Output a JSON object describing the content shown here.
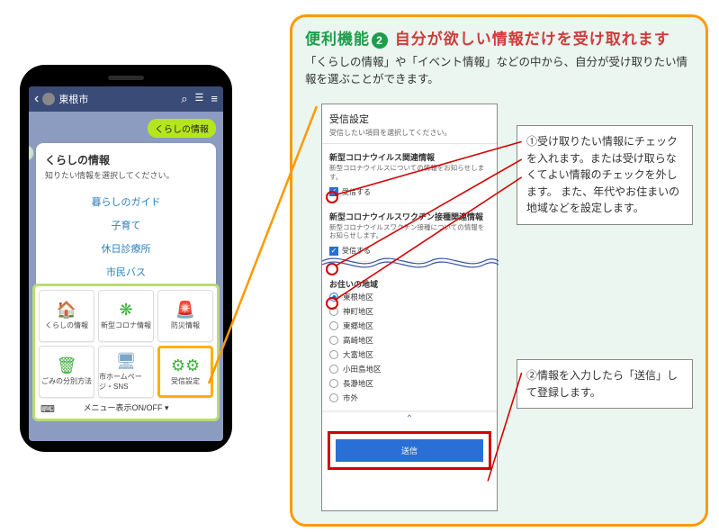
{
  "phone": {
    "app_bar": {
      "title": "東根市"
    },
    "bubble_right": "くらしの情報",
    "card": {
      "title": "くらしの情報",
      "subtitle": "知りたい情報を選択してください。",
      "links": [
        "暮らしのガイド",
        "子育て",
        "休日診療所",
        "市民バス"
      ]
    },
    "tiles": [
      {
        "label": "くらしの情報",
        "icon": "🏠",
        "color": "ic-green"
      },
      {
        "label": "新型コロナ情報",
        "icon": "❋",
        "color": "ic-green"
      },
      {
        "label": "防災情報",
        "icon": "🚨",
        "color": "ic-yellow"
      },
      {
        "label": "ごみの分別方法",
        "icon": "🗑",
        "color": "ic-green"
      },
      {
        "label": "市ホームページ・SNS",
        "icon": "🖥",
        "color": "ic-blue"
      },
      {
        "label": "受信設定",
        "icon": "⚙⚙",
        "color": "ic-green",
        "highlight": true
      }
    ],
    "menu_toggle": "メニュー表示ON/OFF ▾"
  },
  "feature": {
    "label_prefix": "便利機能",
    "badge_number": "2",
    "headline": "自分が欲しい情報だけを受け取れます",
    "subtitle": "「くらしの情報」や「イベント情報」などの中から、自分が受け取りたい情報を選ぶことができます。"
  },
  "settings": {
    "header_title": "受信設定",
    "header_sub": "受信したい項目を選択してください。",
    "sections": [
      {
        "title": "新型コロナウイルス関連情報",
        "desc": "新型コロナウイルスについての情報をお知らせします。",
        "receive_label": "受信する"
      },
      {
        "title": "新型コロナウイルスワクチン接種関連情報",
        "desc": "新型コロナウイルスワクチン接種についての情報をお知らせします。",
        "receive_label": "受信する"
      }
    ],
    "region_label": "お住いの地域",
    "regions": [
      {
        "label": "東根地区",
        "selected": true
      },
      {
        "label": "神町地区"
      },
      {
        "label": "東郷地区"
      },
      {
        "label": "高崎地区"
      },
      {
        "label": "大富地区"
      },
      {
        "label": "小田島地区"
      },
      {
        "label": "長瀞地区"
      },
      {
        "label": "市外"
      }
    ],
    "expand_glyph": "⌃",
    "submit_label": "送信"
  },
  "notes": {
    "n1": "①受け取りたい情報にチェックを入れます。または受け取らなくてよい情報のチェックを外します。\nまた、年代やお住まいの地域などを設定します。",
    "n2": "②情報を入力したら「送信」して登録します。"
  }
}
